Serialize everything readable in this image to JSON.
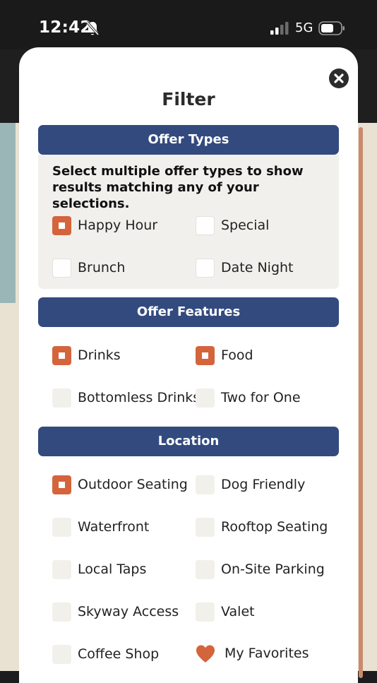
{
  "status_bar": {
    "time": "12:42",
    "network": "5G",
    "icons": [
      "bell-slash-icon",
      "signal-icon",
      "battery-icon"
    ]
  },
  "modal": {
    "title": "Filter",
    "close_icon": "close-icon"
  },
  "offer_types": {
    "header": "Offer Types",
    "instructions": "Select multiple offer types to show results matching any of your selections.",
    "options": [
      {
        "label": "Happy Hour",
        "checked": true
      },
      {
        "label": "Special",
        "checked": false
      },
      {
        "label": "Brunch",
        "checked": false
      },
      {
        "label": "Date Night",
        "checked": false
      }
    ]
  },
  "offer_features": {
    "header": "Offer Features",
    "options": [
      {
        "label": "Drinks",
        "checked": true
      },
      {
        "label": "Food",
        "checked": true
      },
      {
        "label": "Bottomless Drinks",
        "checked": false
      },
      {
        "label": "Two for One",
        "checked": false
      }
    ]
  },
  "location": {
    "header": "Location",
    "options": [
      {
        "label": "Outdoor Seating",
        "checked": true
      },
      {
        "label": "Dog Friendly",
        "checked": false
      },
      {
        "label": "Waterfront",
        "checked": false
      },
      {
        "label": "Rooftop Seating",
        "checked": false
      },
      {
        "label": "Local Taps",
        "checked": false
      },
      {
        "label": "On-Site Parking",
        "checked": false
      },
      {
        "label": "Skyway Access",
        "checked": false
      },
      {
        "label": "Valet",
        "checked": false
      },
      {
        "label": "Coffee Shop",
        "checked": false
      },
      {
        "label": "My Favorites",
        "checked": false,
        "icon": "heart-icon"
      }
    ]
  },
  "colors": {
    "accent": "#d4643b",
    "header_bg": "#334a7f",
    "panel_bg": "#f1f0ec"
  }
}
